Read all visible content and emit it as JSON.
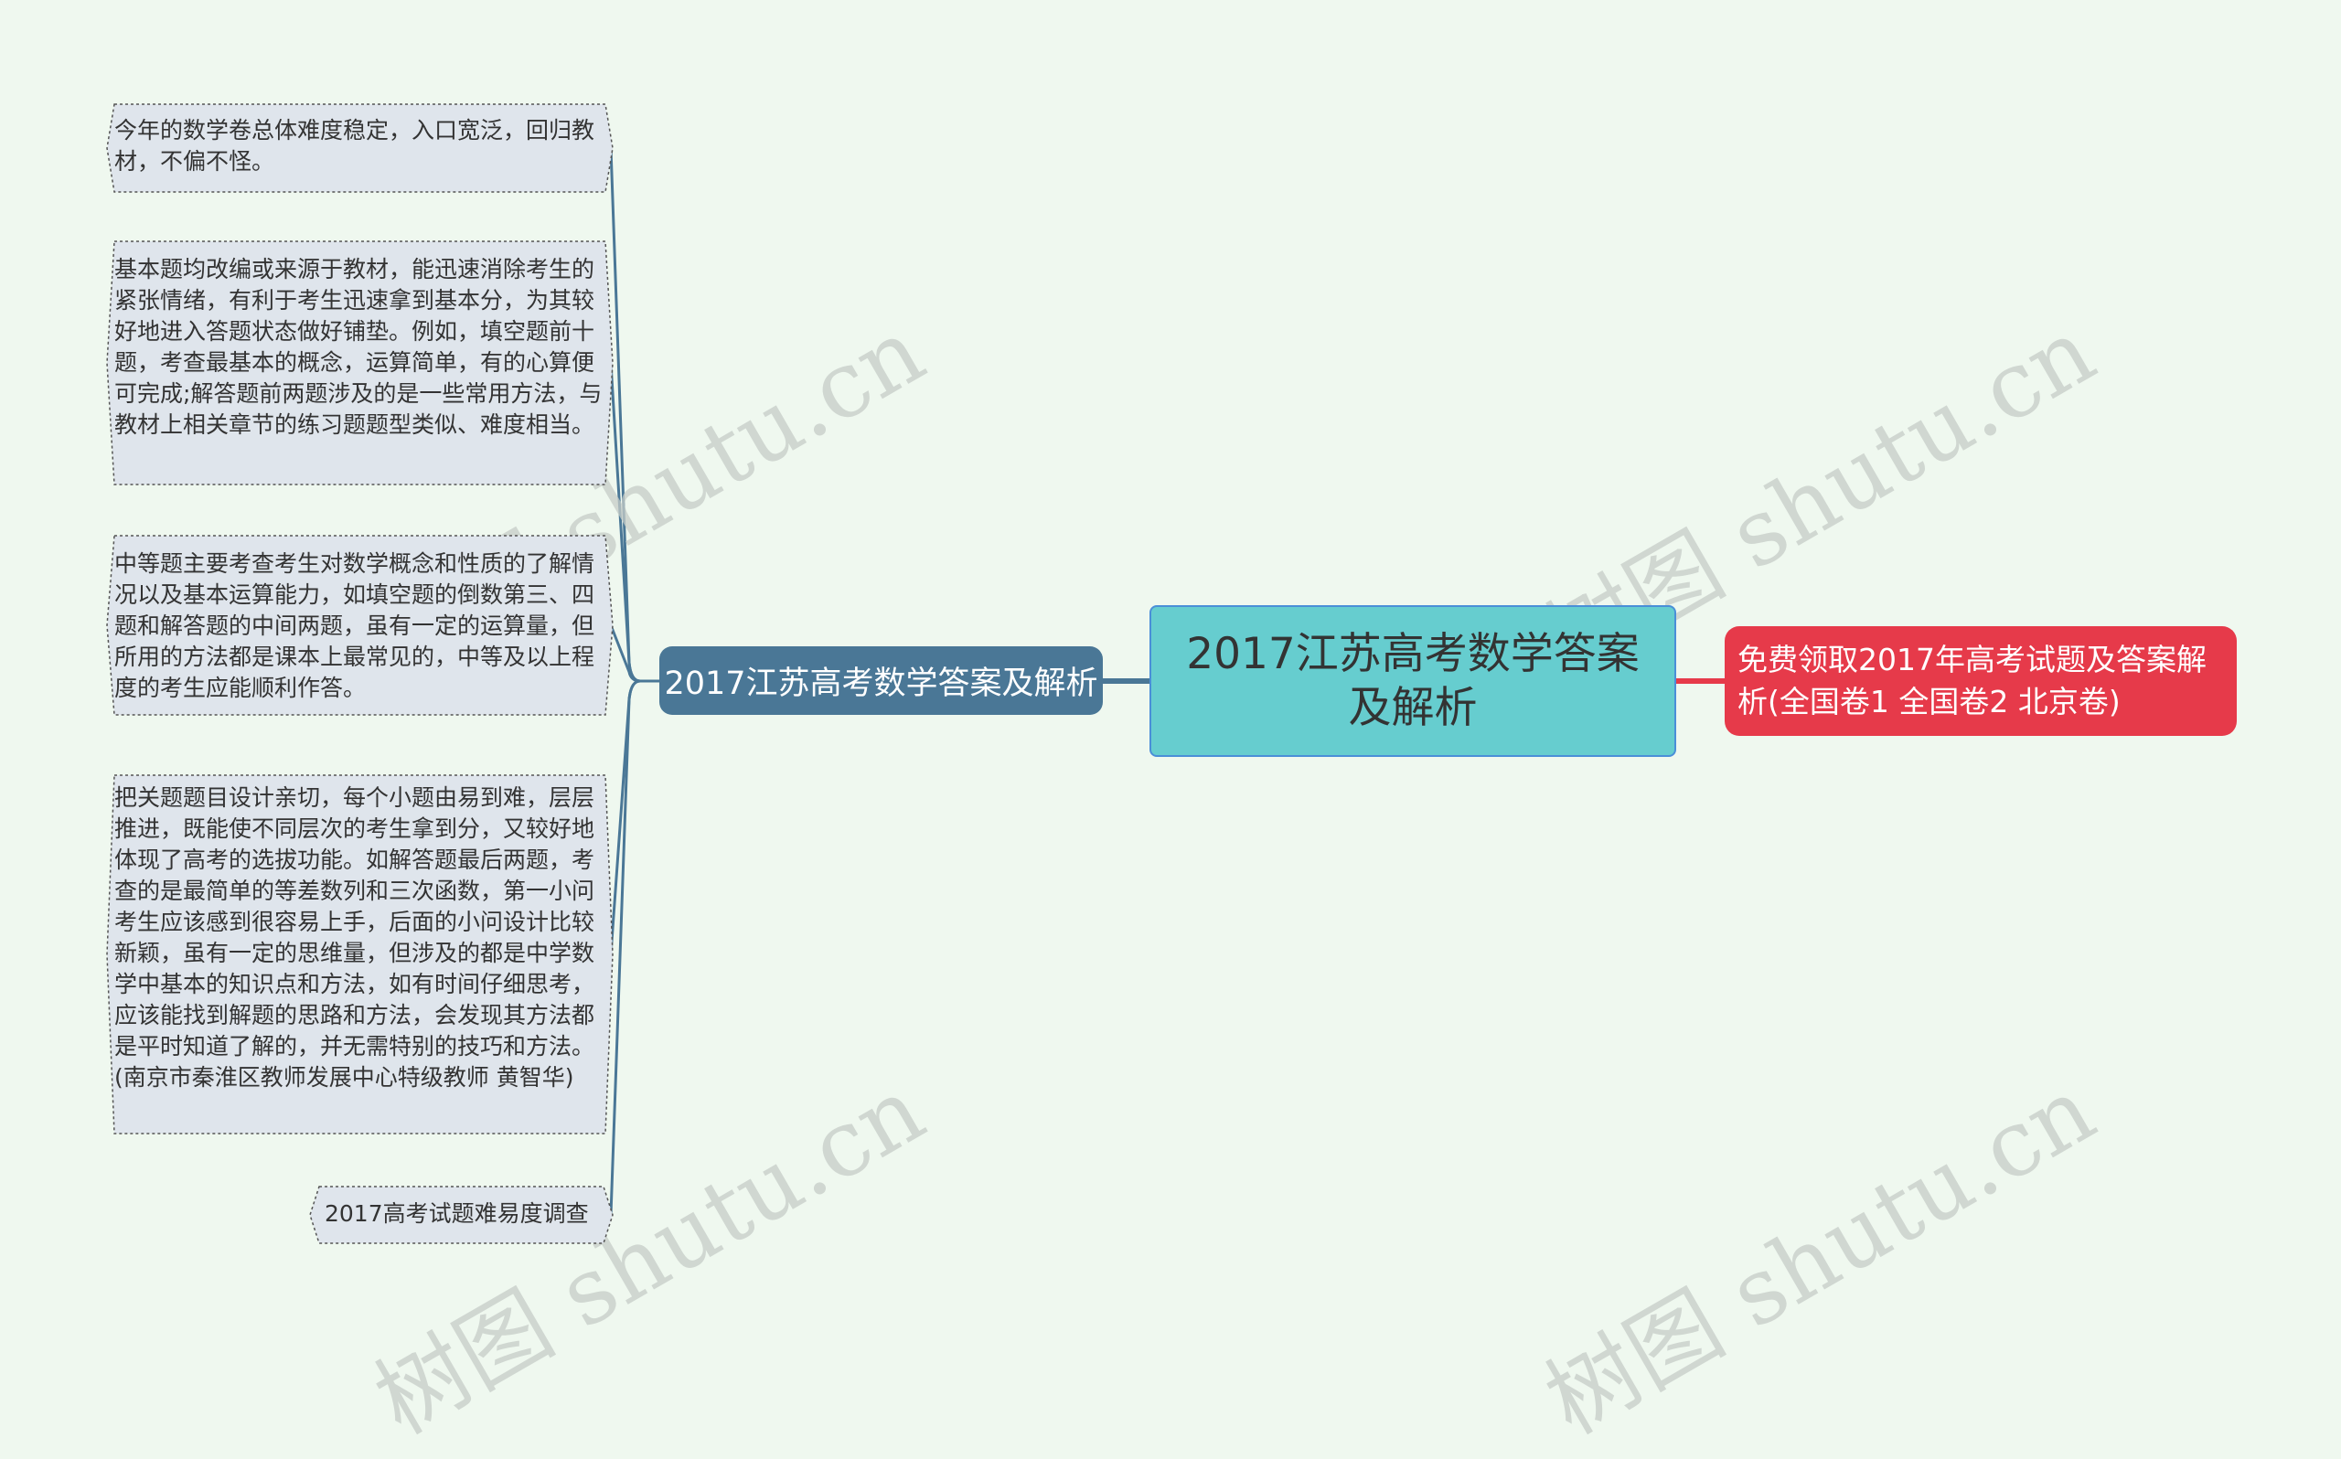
{
  "root": {
    "label": "2017江苏高考数学答案及解析"
  },
  "branch": {
    "label": "2017江苏高考数学答案及解析"
  },
  "promo": {
    "label": "免费领取2017年高考试题及答案解析(全国卷1 全国卷2 北京卷)"
  },
  "leaves": [
    "今年的数学卷总体难度稳定，入口宽泛，回归教材，不偏不怪。",
    "基本题均改编或来源于教材，能迅速消除考生的紧张情绪，有利于考生迅速拿到基本分，为其较好地进入答题状态做好铺垫。例如，填空题前十题，考查最基本的概念，运算简单，有的心算便可完成;解答题前两题涉及的是一些常用方法，与教材上相关章节的练习题题型类似、难度相当。",
    "中等题主要考查考生对数学概念和性质的了解情况以及基本运算能力，如填空题的倒数第三、四题和解答题的中间两题，虽有一定的运算量，但所用的方法都是课本上最常见的，中等及以上程度的考生应能顺利作答。",
    "把关题题目设计亲切，每个小题由易到难，层层推进，既能使不同层次的考生拿到分，又较好地体现了高考的选拔功能。如解答题最后两题，考查的是最简单的等差数列和三次函数，第一小问考生应该感到很容易上手，后面的小问设计比较新颖，虽有一定的思维量，但涉及的都是中学数学中基本的知识点和方法，如有时间仔细思考，应该能找到解题的思路和方法，会发现其方法都是平时知道了解的，并无需特别的技巧和方法。(南京市秦淮区教师发展中心特级教师 黄智华)",
    "2017高考试题难易度调查"
  ],
  "watermark": "树图 shutu.cn",
  "colors": {
    "background": "#eff8ef",
    "root_fill": "#66cdcf",
    "root_border": "#4a8fd8",
    "branch_fill": "#4a7796",
    "promo_fill": "#e63a4a",
    "leaf_fill": "#dfe5ec",
    "line": "#4a7796"
  }
}
